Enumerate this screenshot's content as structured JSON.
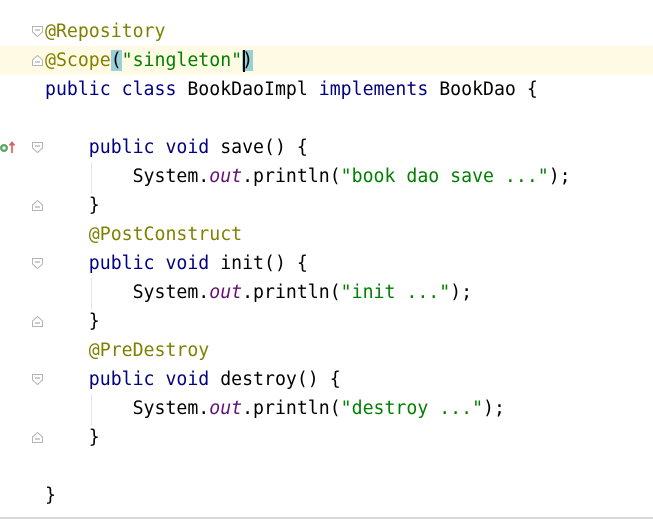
{
  "code": {
    "lines": [
      {
        "tokens": [
          {
            "t": "@Repository",
            "c": "ann"
          }
        ]
      },
      {
        "tokens": [
          {
            "t": "@Scope",
            "c": "ann"
          },
          {
            "t": "(",
            "c": "bracket"
          },
          {
            "t": "\"singleton\"",
            "c": "str"
          },
          {
            "t": ")",
            "c": "bracket"
          }
        ]
      },
      {
        "tokens": [
          {
            "t": "public class ",
            "c": "kw"
          },
          {
            "t": "BookDaoImpl ",
            "c": "plain"
          },
          {
            "t": "implements ",
            "c": "kw"
          },
          {
            "t": "BookDao {",
            "c": "plain"
          }
        ]
      },
      {
        "tokens": []
      },
      {
        "tokens": [
          {
            "t": "    public void ",
            "c": "kw"
          },
          {
            "t": "save() {",
            "c": "plain"
          }
        ]
      },
      {
        "tokens": [
          {
            "t": "        System.",
            "c": "plain"
          },
          {
            "t": "out",
            "c": "fld"
          },
          {
            "t": ".println(",
            "c": "plain"
          },
          {
            "t": "\"book dao save ...\"",
            "c": "str"
          },
          {
            "t": ");",
            "c": "plain"
          }
        ]
      },
      {
        "tokens": [
          {
            "t": "    }",
            "c": "plain"
          }
        ]
      },
      {
        "tokens": [
          {
            "t": "    @PostConstruct",
            "c": "ann"
          }
        ]
      },
      {
        "tokens": [
          {
            "t": "    public void ",
            "c": "kw"
          },
          {
            "t": "init() {",
            "c": "plain"
          }
        ]
      },
      {
        "tokens": [
          {
            "t": "        System.",
            "c": "plain"
          },
          {
            "t": "out",
            "c": "fld"
          },
          {
            "t": ".println(",
            "c": "plain"
          },
          {
            "t": "\"init ...\"",
            "c": "str"
          },
          {
            "t": ");",
            "c": "plain"
          }
        ]
      },
      {
        "tokens": [
          {
            "t": "    }",
            "c": "plain"
          }
        ]
      },
      {
        "tokens": [
          {
            "t": "    @PreDestroy",
            "c": "ann"
          }
        ]
      },
      {
        "tokens": [
          {
            "t": "    public void ",
            "c": "kw"
          },
          {
            "t": "destroy() {",
            "c": "plain"
          }
        ]
      },
      {
        "tokens": [
          {
            "t": "        System.",
            "c": "plain"
          },
          {
            "t": "out",
            "c": "fld"
          },
          {
            "t": ".println(",
            "c": "plain"
          },
          {
            "t": "\"destroy ...\"",
            "c": "str"
          },
          {
            "t": ");",
            "c": "plain"
          }
        ]
      },
      {
        "tokens": [
          {
            "t": "    }",
            "c": "plain"
          }
        ]
      },
      {
        "tokens": []
      },
      {
        "tokens": [
          {
            "t": "}",
            "c": "plain"
          }
        ]
      }
    ]
  },
  "colors": {
    "keyword": "#000080",
    "annotation": "#808000",
    "string": "#008000",
    "static_field": "#660e7a",
    "current_line": "#fffae3",
    "bracket_match": "#99d0d8"
  },
  "icons": {
    "gutter_run": "implemented-method-icon",
    "fold": "fold-marker-icon"
  }
}
